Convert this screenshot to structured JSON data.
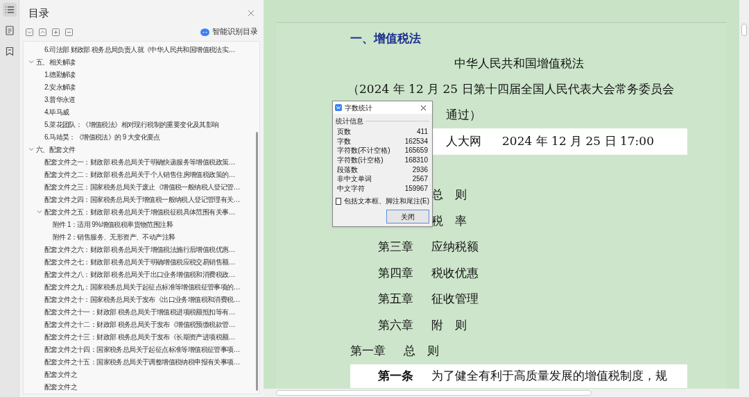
{
  "rail": [
    {
      "kind": "toc",
      "selected": true
    },
    {
      "kind": "page",
      "selected": false
    },
    {
      "kind": "bookmark",
      "selected": false
    }
  ],
  "toc_panel": {
    "title": "目录",
    "smart_button": "智能识别目录",
    "continued_items": [
      {
        "label": "6.司法部 财政部 税务总局负责人就《中华人民共和国增值税法实…"
      }
    ],
    "items": [
      {
        "label": "五、相关解读",
        "expanded": true,
        "children": [
          {
            "label": "1.德勤解读"
          },
          {
            "label": "2.安永解读"
          },
          {
            "label": "3.普华永道"
          },
          {
            "label": "4.毕马威"
          },
          {
            "label": "5.菜花团队：《增值税法》相对现行税制的重要变化及其影响"
          },
          {
            "label": "6.马靖昊：《增值税法》的 9 大变化要点"
          }
        ]
      },
      {
        "label": "六、配套文件",
        "expanded": true,
        "children": [
          {
            "label": "配套文件之一：财政部 税务总局关于明确快递服务等增值税政策…"
          },
          {
            "label": "配套文件之二：财政部 税务总局关于个人销售住房增值税政策的…"
          },
          {
            "label": "配套文件之三：国家税务总局关于废止《增值税一般纳税人登记管…"
          },
          {
            "label": "配套文件之四：国家税务总局关于增值税一般纳税人登记管理有关…"
          },
          {
            "label": "配套文件之五：财政部 税务总局关于增值税征税具体范围有关事…",
            "expanded": true,
            "children": [
              {
                "label": "附件 1：适用 9%增值税税率货物范围注释"
              },
              {
                "label": "附件 2：销售服务、无形资产、不动产注释"
              }
            ]
          },
          {
            "label": "配套文件之六：财政部 税务总局关于增值税法施行后增值税优惠…"
          },
          {
            "label": "配套文件之七：财政部 税务总局关于明确增值税应税交易销售额…"
          },
          {
            "label": "配套文件之八：财政部 税务总局关于出口业务增值税和消费税政…"
          },
          {
            "label": "配套文件之九：国家税务总局关于起征点标准等增值税征管事项的…"
          },
          {
            "label": "配套文件之十：国家税务总局关于发布《出口业务增值税和消费税…"
          },
          {
            "label": "配套文件之十一：财政部 税务总局关于增值税进项税额抵扣等有…"
          },
          {
            "label": "配套文件之十二：财政部 税务总局关于发布《增值税预缴税款管…"
          },
          {
            "label": "配套文件之十三：财政部 税务总局关于发布《长期资产进项税额…"
          },
          {
            "label": "配套文件之十四：国家税务总局关于起征点标准等增值税征管事项…"
          },
          {
            "label": "配套文件之十五：国家税务总局关于调整增值税纳税申报有关事项…"
          },
          {
            "label": "配套文件之"
          },
          {
            "label": "配套文件之"
          }
        ]
      }
    ]
  },
  "document": {
    "heading": "一、增值税法",
    "title": "中华人民共和国增值税法",
    "subtitle": "（2024 年 12 月 25 日第十四届全国人民代表大会常务委员会",
    "subtitle_end": "通过）",
    "source": "人大网",
    "source_time": "2024 年 12 月 25 日  17:00",
    "contents": [
      {
        "name": "总　则"
      },
      {
        "name": "税　率"
      },
      {
        "number": "第三章",
        "name": "应纳税额"
      },
      {
        "number": "第四章",
        "name": "税收优惠"
      },
      {
        "number": "第五章",
        "name": "征收管理"
      },
      {
        "number": "第六章",
        "name": "附　则"
      }
    ],
    "chapter": {
      "number": "第一章",
      "name": "总　则"
    },
    "article": {
      "number": "第一条",
      "text": "为了健全有利于高质量发展的增值税制度，规"
    }
  },
  "dialog": {
    "title": "字数统计",
    "group": "统计信息",
    "rows": [
      {
        "label": "页数",
        "value": "411"
      },
      {
        "label": "字数",
        "value": "162534"
      },
      {
        "label": "字符数(不计空格)",
        "value": "165659"
      },
      {
        "label": "字符数(计空格)",
        "value": "168310"
      },
      {
        "label": "段落数",
        "value": "2936"
      },
      {
        "label": "非中文单词",
        "value": "2567"
      },
      {
        "label": "中文字符",
        "value": "159967"
      }
    ],
    "checkbox": {
      "label": "包括文本框、脚注和尾注(E)",
      "checked": false
    },
    "button": "关闭"
  }
}
